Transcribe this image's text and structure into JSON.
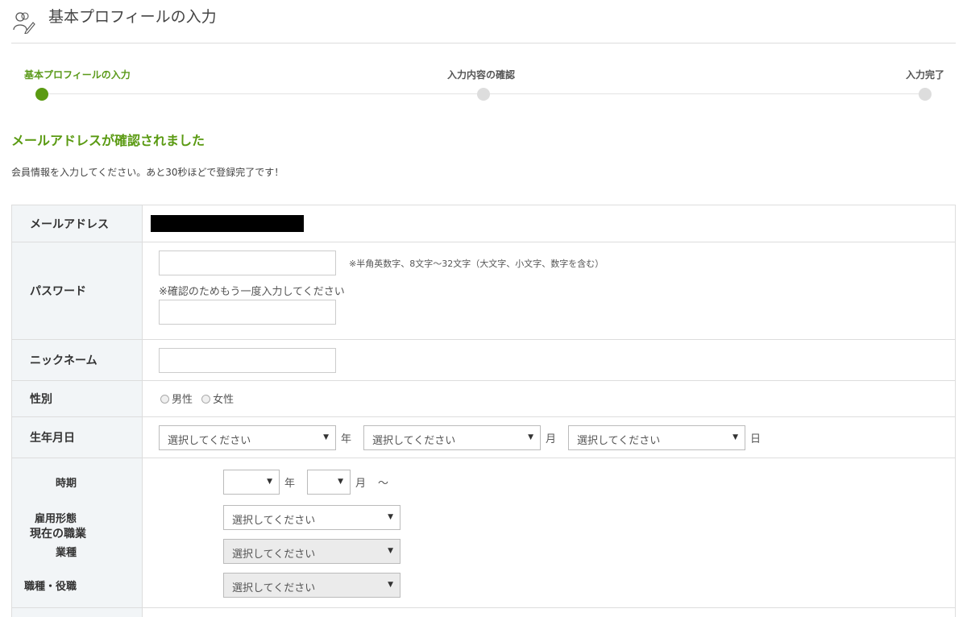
{
  "header": {
    "title": "基本プロフィールの入力",
    "icon": "people-edit-icon"
  },
  "steps": [
    {
      "label": "基本プロフィールの入力",
      "active": true
    },
    {
      "label": "入力内容の確認",
      "active": false
    },
    {
      "label": "入力完了",
      "active": false
    }
  ],
  "section_title": "メールアドレスが確認されました",
  "intro": "会員情報を入力してください。あと30秒ほどで登録完了です！",
  "form": {
    "email": {
      "label": "メールアドレス"
    },
    "password": {
      "label": "パスワード",
      "hint": "※半角英数字、8文字〜32文字（大文字、小文字、数字を含む）",
      "confirm_note": "※確認のためもう一度入力してください"
    },
    "nickname": {
      "label": "ニックネーム"
    },
    "gender": {
      "label": "性別",
      "options": [
        "男性",
        "女性"
      ]
    },
    "birthdate": {
      "label": "生年月日",
      "placeholder": "選択してください",
      "year_unit": "年",
      "month_unit": "月",
      "day_unit": "日"
    },
    "current_job": {
      "label": "現在の職業",
      "period_label": "時期",
      "year_unit": "年",
      "month_unit": "月",
      "tilde": "〜",
      "employment_label": "雇用形態",
      "industry_label": "業種",
      "role_label": "職種・役職",
      "placeholder": "選択してください"
    }
  },
  "colors": {
    "accent": "#5a9a12",
    "header_bg": "#f2f5f7",
    "border": "#dddddd"
  }
}
